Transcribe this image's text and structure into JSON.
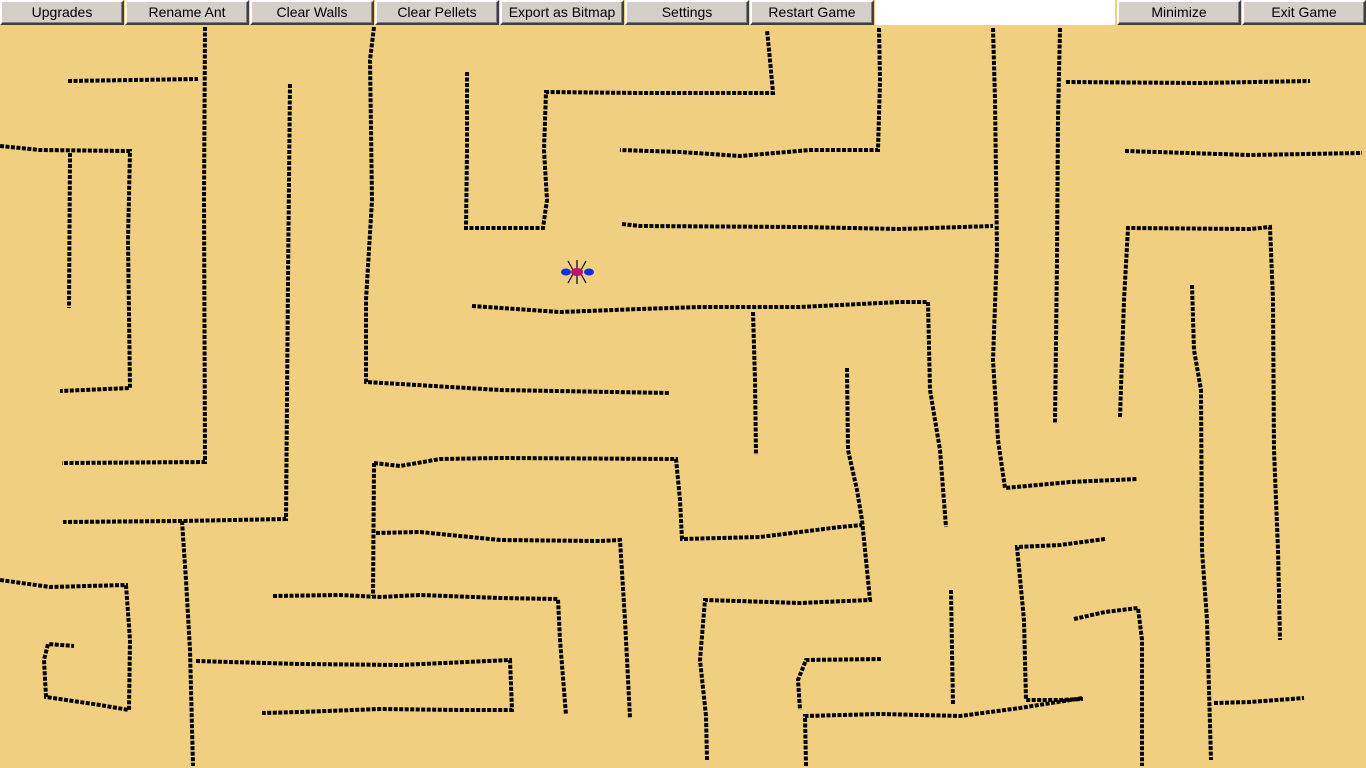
{
  "toolbar": {
    "upgrades": "Upgrades",
    "rename_ant": "Rename Ant",
    "clear_walls": "Clear Walls",
    "clear_pellets": "Clear Pellets",
    "export_bitmap": "Export as Bitmap",
    "settings": "Settings",
    "restart_game": "Restart Game",
    "name_field_value": "",
    "minimize": "Minimize",
    "exit_game": "Exit Game"
  },
  "colors": {
    "background": "#f0d080",
    "wall": "#000000",
    "ant_body": "#c01070",
    "ant_accent": "#1030e0"
  },
  "icons": {
    "player": "ant-icon"
  }
}
